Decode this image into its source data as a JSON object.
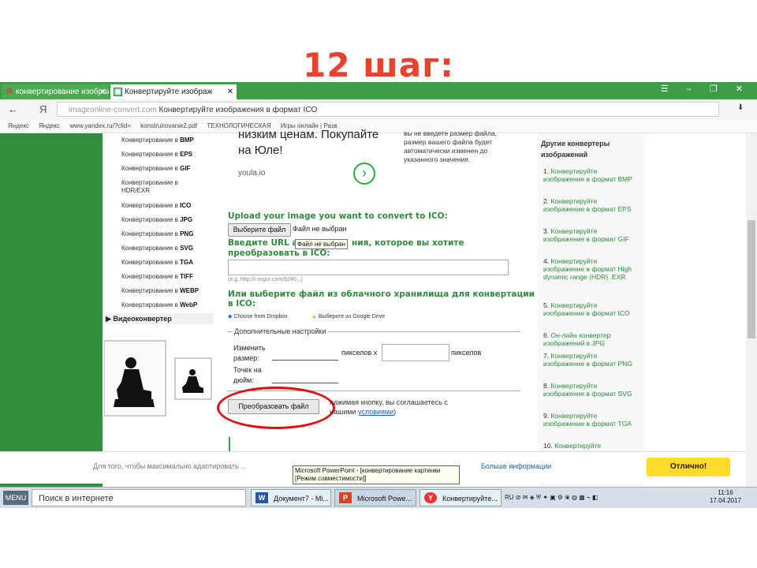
{
  "slide_title": "12 шаг:",
  "tabs": [
    {
      "label": "конвертирование изображ",
      "icon": "yandex-icon"
    },
    {
      "label": "Конвертируйте изображ",
      "icon": "converter-icon"
    }
  ],
  "window_controls": "☰ – ❐ ✕",
  "address_bar": {
    "back": "←",
    "yandex": "Я",
    "domain": "imageonline-convert.com",
    "title": " Конвертируйте изображения в формат ICO"
  },
  "bookmarks": [
    "Яндекс",
    "Яндекс",
    "www.yandex.ru/?clid=",
    "konstruirovanie2.pdf",
    "ТЕХНОЛОГИЧЕСКАЯ",
    "Игры онлайн | Разв"
  ],
  "left_menu": [
    {
      "text": "Конвертирование в ",
      "bold": "BMP"
    },
    {
      "text": "Конвертирование в ",
      "bold": "EPS"
    },
    {
      "text": "Конвертирование в ",
      "bold": "GIF"
    },
    {
      "text": "Конвертирование в HDR/EXR",
      "bold": ""
    },
    {
      "text": "Конвертирование в ",
      "bold": "ICO"
    },
    {
      "text": "Конвертирование в ",
      "bold": "JPG"
    },
    {
      "text": "Конвертирование в ",
      "bold": "PNG"
    },
    {
      "text": "Конвертирование в ",
      "bold": "SVG"
    },
    {
      "text": "Конвертирование в ",
      "bold": "TGA"
    },
    {
      "text": "Конвертирование в ",
      "bold": "TIFF"
    },
    {
      "text": "Конвертирование в ",
      "bold": "WEBP"
    },
    {
      "text": "Конвертирование в ",
      "bold": "WebP"
    }
  ],
  "video_converter": "▶  Видеоконвертер",
  "ad": {
    "line1": "низким ценам. Покупайте",
    "line2": "на Юле!",
    "source": "youla.io"
  },
  "ad_note": {
    "line1": "вы не введете размер файла,",
    "line2": "размер вашего файла будет",
    "line3": "автоматически изменен до",
    "line4": "указанного значения."
  },
  "upload": {
    "label": "Upload your image you want to convert to ICO:",
    "button": "Выберите файл",
    "no_file": "Файл не выбран",
    "tooltip": "Файл не выбран"
  },
  "url_section": {
    "label_a": "Введите URL ад",
    "label_b": "ния, которое вы хотите",
    "label_c": "преобразовать в ICO:",
    "value": "",
    "hint": "(e.g. http://i.imgur.com/6240...)"
  },
  "cloud": {
    "label1": "Или выберите файл из облачного хранилища для конвертации",
    "label2": "в ICO:",
    "dropbox": "Choose from Dropbox",
    "gdrive": "Выберите из Google Drive"
  },
  "settings": {
    "legend": "Дополнительные настройки",
    "resize_l1": "Изменить",
    "resize_l2": "размер:",
    "px_x": "пикселов x",
    "px": "пикселов",
    "dpi_l1": "Точек на",
    "dpi_l2": "дюйм:"
  },
  "convert_button": "Преобразовать файл",
  "agree": {
    "text1": "нажимая кнопку, вы соглашаетесь с",
    "text2": "нашими ",
    "link": "условиями",
    "text3": ")"
  },
  "right_column": {
    "title_l1": "Другие конвертеры",
    "title_l2": "изображений",
    "items": [
      "Конвертируйте изображение в формат BMP",
      "Конвертируйте изображение в формат EPS",
      "Конвертируйте изображение в формат GIF",
      "Конвертируйте изображение в формат High dynamic range (HDR) .EXR",
      "Конвертируйте изображение в формат ICO",
      "Он-лайн конвертер изображений в JPG",
      "Конвертируйте изображение в формат PNG",
      "Конвертируйте изображение в формат SVG",
      "Конвертируйте изображение в формат TGA",
      "Конвертируйте"
    ]
  },
  "cookie": {
    "text": "Для того, чтобы максимально адаптировать ...",
    "link": "Больше информации",
    "button": "Отлично!"
  },
  "ppt_tooltip": {
    "line1": "Microsoft PowerPoint - [конвертирование картинки",
    "line2": "[Режим совместимости]]"
  },
  "taskbar": {
    "menu": "MENU",
    "search": "Поиск в интернете",
    "apps": [
      {
        "label": "Документ7 - Mi...",
        "icon": "W"
      },
      {
        "label": "Microsoft Powe...",
        "icon": "P"
      },
      {
        "label": "Конвертируйте...",
        "icon": "Y"
      }
    ],
    "tray": "RU  ⊘ ✉ ◈ ⛨ ✦ ▣ ⚙ ⦿ ◍ ▦ ⌁ ◧",
    "time": "11:16",
    "date": "17.04.2017"
  },
  "colors": {
    "title_red": "#e8412c",
    "site_green": "#2f8f3d",
    "annotation_red": "#e01010",
    "ok_yellow": "#ffdb2b"
  }
}
